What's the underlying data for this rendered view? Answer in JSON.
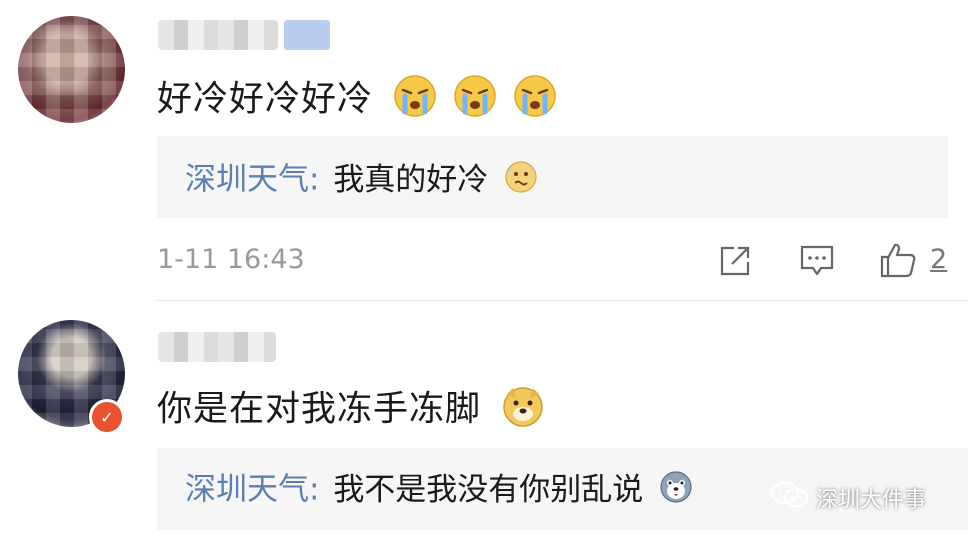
{
  "comments": [
    {
      "text": "好冷好冷好冷",
      "emojis": [
        "crying-face-icon",
        "crying-face-icon",
        "crying-face-icon"
      ],
      "reply_author": "深圳天气:",
      "reply_text": "我真的好冷",
      "reply_emoji": "shivering-face-icon",
      "timestamp": "1-11 16:43",
      "like_count": "2"
    },
    {
      "text": "你是在对我冻手冻脚",
      "emojis": [
        "doge-face-icon"
      ],
      "reply_author": "深圳天气:",
      "reply_text": "我不是我没有你别乱说",
      "reply_emoji": "husky-face-icon"
    }
  ],
  "watermark": "深圳大件事",
  "colors": {
    "reply_author": "#5b7fb0",
    "reply_bg": "#f6f6f6",
    "verified_badge": "#e8522e"
  }
}
